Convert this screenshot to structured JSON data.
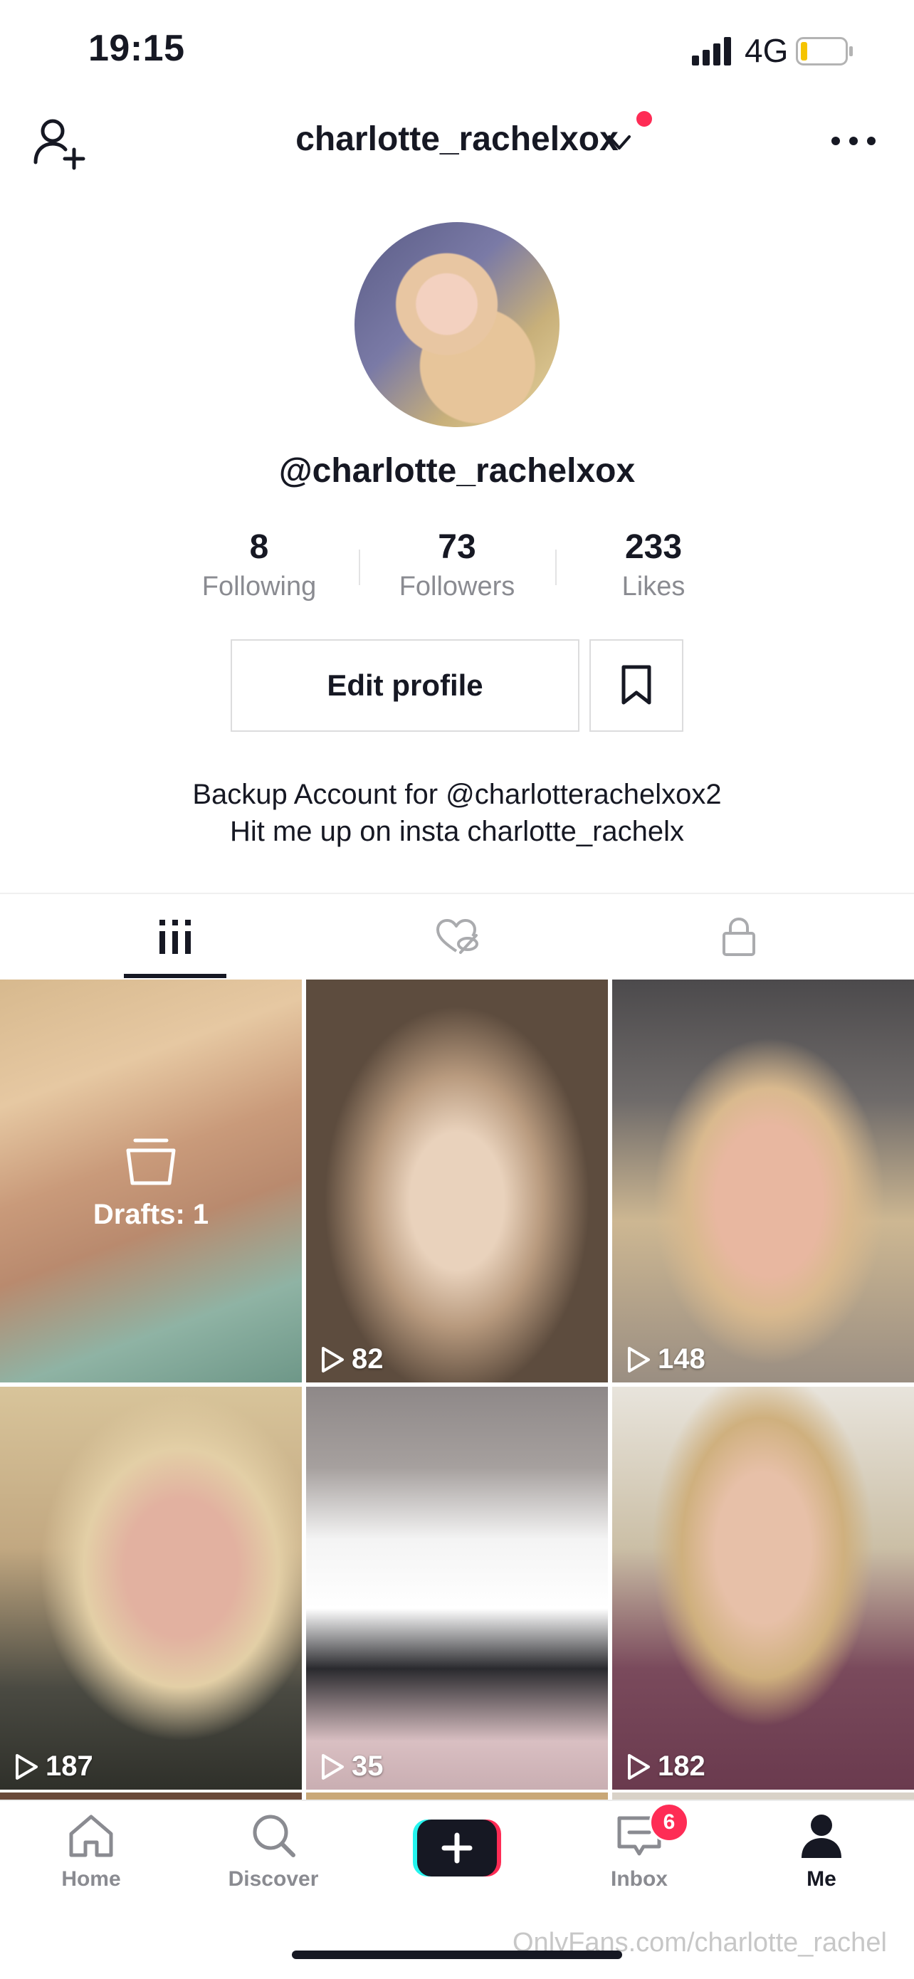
{
  "status_bar": {
    "time": "19:15",
    "network": "4G"
  },
  "header": {
    "username": "charlotte_rachelxox"
  },
  "profile": {
    "handle": "@charlotte_rachelxox",
    "stats": [
      {
        "value": "8",
        "label": "Following"
      },
      {
        "value": "73",
        "label": "Followers"
      },
      {
        "value": "233",
        "label": "Likes"
      }
    ],
    "edit_label": "Edit profile",
    "bio_line1": "Backup Account for @charlotterachelxox2",
    "bio_line2": "Hit me up on insta charlotte_rachelx"
  },
  "tabs": [
    {
      "icon": "videos-grid-icon",
      "active": true
    },
    {
      "icon": "liked-hidden-icon",
      "active": false
    },
    {
      "icon": "lock-icon",
      "active": false
    }
  ],
  "grid": {
    "drafts_label": "Drafts: 1",
    "videos": [
      {
        "views": "82"
      },
      {
        "views": "148"
      },
      {
        "views": "187"
      },
      {
        "views": "35"
      },
      {
        "views": "182"
      }
    ]
  },
  "nav": {
    "home": "Home",
    "discover": "Discover",
    "inbox": "Inbox",
    "inbox_badge": "6",
    "me": "Me"
  },
  "watermark": "OnlyFans.com/charlotte_rachel",
  "colors": {
    "accent": "#fe2c55",
    "text": "#161823",
    "secondary": "#8a8b91"
  }
}
